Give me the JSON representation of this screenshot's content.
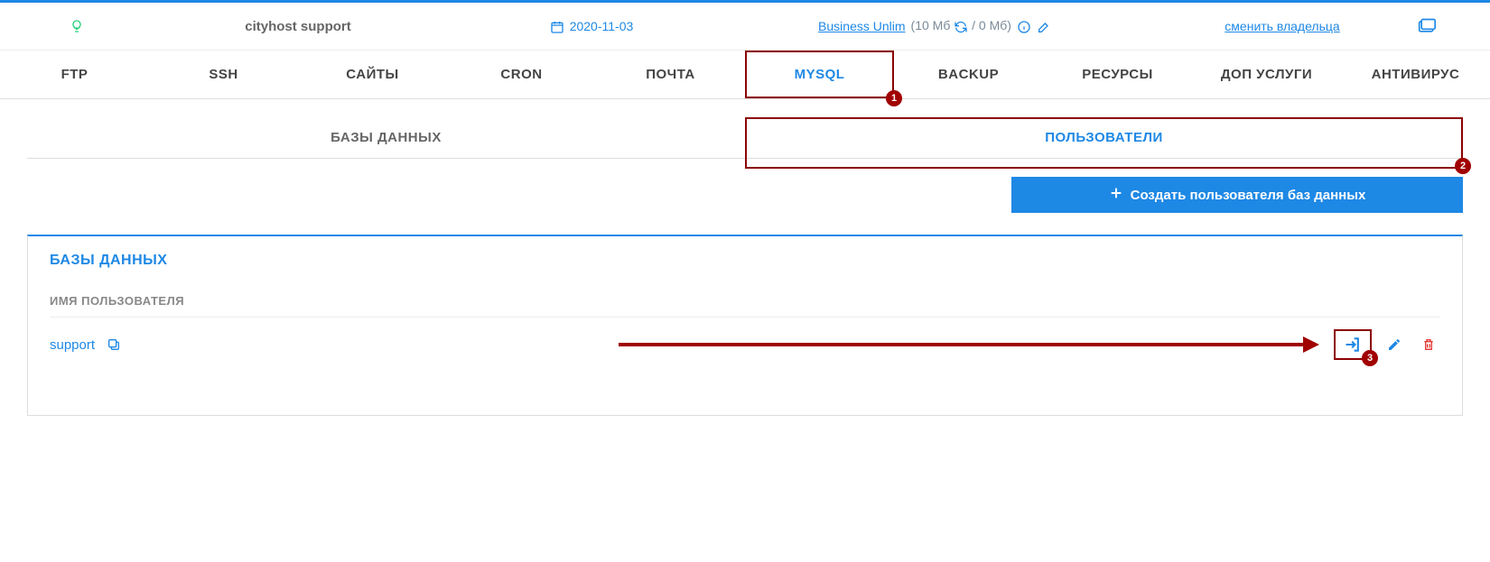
{
  "header": {
    "account_name": "cityhost support",
    "date": "2020-11-03",
    "plan_name": "Business Unlim",
    "usage_open": "(",
    "usage_used": "10 Мб",
    "usage_sep": " / ",
    "usage_total": "0 Мб",
    "usage_close": ")",
    "change_owner": "сменить владельца"
  },
  "tabs": [
    "FTP",
    "SSH",
    "САЙТЫ",
    "CRON",
    "ПОЧТА",
    "MYSQL",
    "BACKUP",
    "РЕСУРСЫ",
    "ДОП УСЛУГИ",
    "АНТИВИРУС"
  ],
  "subtabs": {
    "db": "БАЗЫ ДАННЫХ",
    "users": "ПОЛЬЗОВАТЕЛИ"
  },
  "create_button": "Создать пользователя баз данных",
  "panel": {
    "title": "БАЗЫ ДАННЫХ",
    "column": "ИМЯ ПОЛЬЗОВАТЕЛЯ"
  },
  "users": [
    {
      "name": "support"
    }
  ],
  "badges": {
    "b1": "1",
    "b2": "2",
    "b3": "3"
  }
}
